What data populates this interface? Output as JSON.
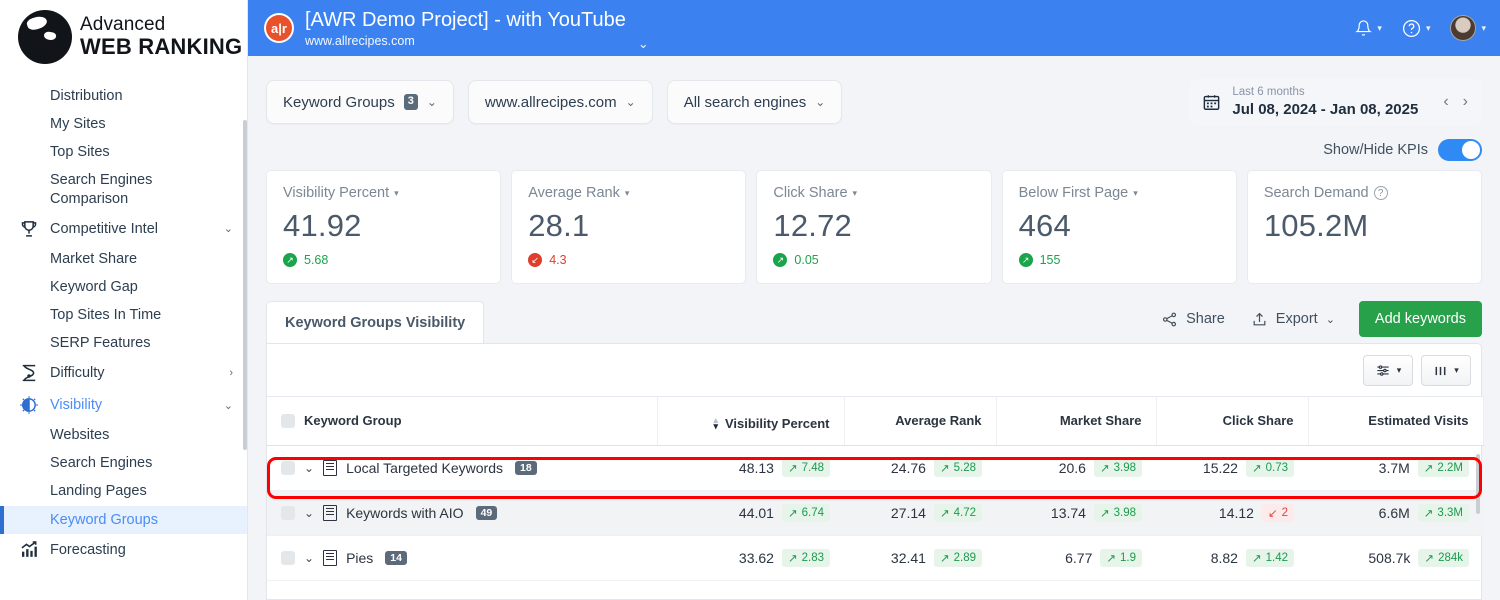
{
  "brand": {
    "line1": "Advanced",
    "line2": "WEB RANKING",
    "logo_icon": "globe-icon"
  },
  "sidebar": {
    "items": [
      {
        "label": "Distribution",
        "icon": null,
        "sub": true,
        "caret": null,
        "active": false
      },
      {
        "label": "My Sites",
        "icon": null,
        "sub": true,
        "caret": null,
        "active": false
      },
      {
        "label": "Top Sites",
        "icon": null,
        "sub": true,
        "caret": null,
        "active": false
      },
      {
        "label": "Search Engines Comparison",
        "icon": null,
        "sub": true,
        "caret": null,
        "active": false
      },
      {
        "label": "Competitive Intel",
        "icon": "trophy-icon",
        "sub": false,
        "caret": "⌄",
        "active": false
      },
      {
        "label": "Market Share",
        "icon": null,
        "sub": true,
        "caret": null,
        "active": false
      },
      {
        "label": "Keyword Gap",
        "icon": null,
        "sub": true,
        "caret": null,
        "active": false
      },
      {
        "label": "Top Sites In Time",
        "icon": null,
        "sub": true,
        "caret": null,
        "active": false
      },
      {
        "label": "SERP Features",
        "icon": null,
        "sub": true,
        "caret": null,
        "active": false
      },
      {
        "label": "Difficulty",
        "icon": "difficulty-icon",
        "sub": false,
        "caret": "›",
        "active": false
      },
      {
        "label": "Visibility",
        "icon": "visibility-icon",
        "sub": false,
        "caret": "⌄",
        "active": false,
        "blue": true
      },
      {
        "label": "Websites",
        "icon": null,
        "sub": true,
        "caret": null,
        "active": false
      },
      {
        "label": "Search Engines",
        "icon": null,
        "sub": true,
        "caret": null,
        "active": false
      },
      {
        "label": "Landing Pages",
        "icon": null,
        "sub": true,
        "caret": null,
        "active": false
      },
      {
        "label": "Keyword Groups",
        "icon": null,
        "sub": true,
        "caret": null,
        "active": true
      },
      {
        "label": "Forecasting",
        "icon": "forecasting-icon",
        "sub": false,
        "caret": null,
        "active": false
      }
    ]
  },
  "topbar": {
    "logo_text": "a|r",
    "project_title": "[AWR Demo Project] - with YouTube",
    "project_domain": "www.allrecipes.com",
    "caret": "⌄",
    "bell_icon": "bell-icon",
    "help_icon": "question-circle-icon",
    "avatar_icon": "avatar",
    "accent": "#3b82f0"
  },
  "filters": {
    "keyword_groups": {
      "label": "Keyword Groups",
      "count": "3"
    },
    "website": {
      "label": "www.allrecipes.com"
    },
    "search_engines": {
      "label": "All search engines"
    },
    "date_range": {
      "preset": "Last 6 months",
      "range": "Jul 08, 2024 - Jan 08, 2025",
      "prev": "‹",
      "next": "›",
      "calendar_icon": "calendar-icon"
    }
  },
  "kpi_section": {
    "toggle_label": "Show/Hide KPIs",
    "toggle_on": true,
    "cards": [
      {
        "title": "Visibility Percent",
        "has_caret": true,
        "value": "41.92",
        "delta": "5.68",
        "direction": "up"
      },
      {
        "title": "Average Rank",
        "has_caret": true,
        "value": "28.1",
        "delta": "4.3",
        "direction": "down"
      },
      {
        "title": "Click Share",
        "has_caret": true,
        "value": "12.72",
        "delta": "0.05",
        "direction": "up"
      },
      {
        "title": "Below First Page",
        "has_caret": true,
        "value": "464",
        "delta": "155",
        "direction": "up"
      },
      {
        "title": "Search Demand",
        "has_caret": false,
        "has_help": true,
        "value": "105.2M",
        "delta": null,
        "direction": null
      }
    ]
  },
  "panel": {
    "tab_label": "Keyword Groups Visibility",
    "share_label": "Share",
    "share_icon": "share-icon",
    "export_label": "Export",
    "export_icon": "upload-icon",
    "export_caret": "⌄",
    "add_keywords_label": "Add keywords",
    "settings_button_icon": "sliders-icon",
    "columns_button_icon": "columns-icon",
    "button_caret": "▾"
  },
  "table": {
    "columns": [
      {
        "label": "Keyword Group",
        "align": "left",
        "sorted": false
      },
      {
        "label": "Visibility Percent",
        "align": "right",
        "sorted": true
      },
      {
        "label": "Average Rank",
        "align": "right",
        "sorted": false
      },
      {
        "label": "Market Share",
        "align": "right",
        "sorted": false
      },
      {
        "label": "Click Share",
        "align": "right",
        "sorted": false
      },
      {
        "label": "Estimated Visits",
        "align": "right",
        "sorted": false
      }
    ],
    "rows": [
      {
        "group": "Local Targeted Keywords",
        "count": "18",
        "highlighted": false,
        "cells": [
          {
            "value": "48.13",
            "delta": "7.48",
            "direction": "up"
          },
          {
            "value": "24.76",
            "delta": "5.28",
            "direction": "up"
          },
          {
            "value": "20.6",
            "delta": "3.98",
            "direction": "up"
          },
          {
            "value": "15.22",
            "delta": "0.73",
            "direction": "up"
          },
          {
            "value": "3.7M",
            "delta": "2.2M",
            "direction": "up"
          }
        ]
      },
      {
        "group": "Keywords with AIO",
        "count": "49",
        "highlighted": true,
        "cells": [
          {
            "value": "44.01",
            "delta": "6.74",
            "direction": "up"
          },
          {
            "value": "27.14",
            "delta": "4.72",
            "direction": "up"
          },
          {
            "value": "13.74",
            "delta": "3.98",
            "direction": "up"
          },
          {
            "value": "14.12",
            "delta": "2",
            "direction": "down"
          },
          {
            "value": "6.6M",
            "delta": "3.3M",
            "direction": "up"
          }
        ]
      },
      {
        "group": "Pies",
        "count": "14",
        "highlighted": false,
        "cells": [
          {
            "value": "33.62",
            "delta": "2.83",
            "direction": "up"
          },
          {
            "value": "32.41",
            "delta": "2.89",
            "direction": "up"
          },
          {
            "value": "6.77",
            "delta": "1.9",
            "direction": "up"
          },
          {
            "value": "8.82",
            "delta": "1.42",
            "direction": "up"
          },
          {
            "value": "508.7k",
            "delta": "284k",
            "direction": "up"
          }
        ]
      }
    ]
  },
  "colors": {
    "brand_blue": "#3b82f0",
    "accent_green": "#27a14a",
    "up": "#1aa44b",
    "down": "#e03e2d",
    "highlight_outline": "#fe0000"
  }
}
